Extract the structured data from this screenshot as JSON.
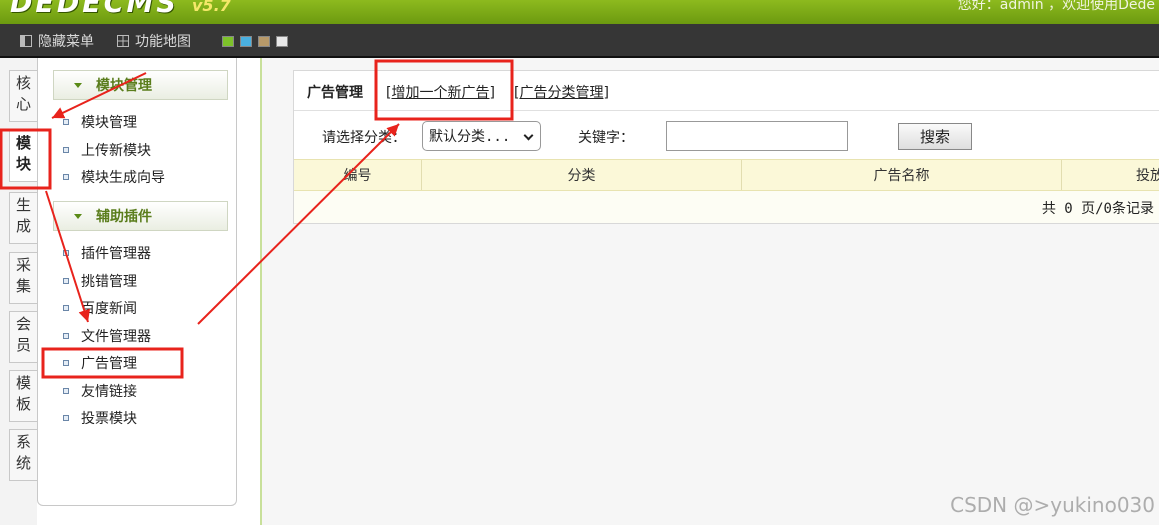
{
  "header": {
    "logo": "DEDECMS",
    "version": "v5.7",
    "welcome": "您好：admin ，欢迎使用Dede"
  },
  "menubar": {
    "hide_menu": "隐藏菜单",
    "function_map": "功能地图",
    "skins": [
      "#7dc22a",
      "#4ab0e0",
      "#b89a6a",
      "#e8e8e8"
    ]
  },
  "vtabs": [
    "核心",
    "模块",
    "生成",
    "采集",
    "会员",
    "模板",
    "系统"
  ],
  "left_panel": {
    "section1": {
      "title": "模块管理",
      "items": [
        "模块管理",
        "上传新模块",
        "模块生成向导"
      ]
    },
    "section2": {
      "title": "辅助插件",
      "items": [
        "插件管理器",
        "挑错管理",
        "百度新闻",
        "文件管理器",
        "广告管理",
        "友情链接",
        "投票模块"
      ]
    }
  },
  "main": {
    "title": "广告管理",
    "add_link": "增加一个新广告",
    "cat_link": "广告分类管理",
    "filter": {
      "category_label": "请选择分类：",
      "category_value": "默认分类...",
      "keyword_label": "关键字：",
      "keyword_value": "",
      "search_button": "搜索"
    },
    "table_headers": [
      "编号",
      "分类",
      "广告名称",
      "投放"
    ],
    "pager": "共 0 页/0条记录"
  },
  "watermark": "CSDN @>yukino030"
}
